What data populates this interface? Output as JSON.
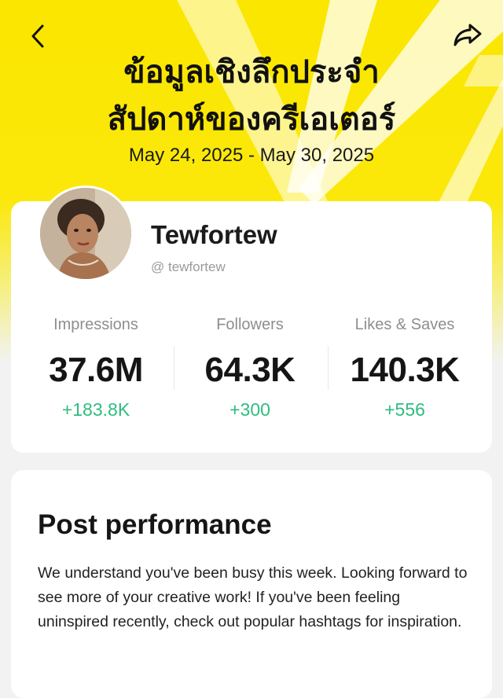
{
  "header": {
    "title_line1": "ข้อมูลเชิงลึกประจำ",
    "title_line2": "สัปดาห์ของครีเอเตอร์",
    "date_range": "May 24, 2025 - May 30, 2025",
    "background_color": "#fbe600"
  },
  "icons": {
    "back": "chevron-left-icon",
    "share": "share-arrow-icon"
  },
  "profile": {
    "name": "Tewfortew",
    "handle": "@ tewfortew"
  },
  "stats": [
    {
      "label": "Impressions",
      "value": "37.6M",
      "change": "+183.8K"
    },
    {
      "label": "Followers",
      "value": "64.3K",
      "change": "+300"
    },
    {
      "label": "Likes & Saves",
      "value": "140.3K",
      "change": "+556"
    }
  ],
  "colors": {
    "accent_yellow": "#fbe600",
    "positive_change": "#2ebd7f"
  },
  "post_performance": {
    "heading": "Post performance",
    "message": "We understand you've been busy this week. Looking forward to see more of your creative work! If you've been feeling uninspired recently, check out popular hashtags for inspiration."
  }
}
